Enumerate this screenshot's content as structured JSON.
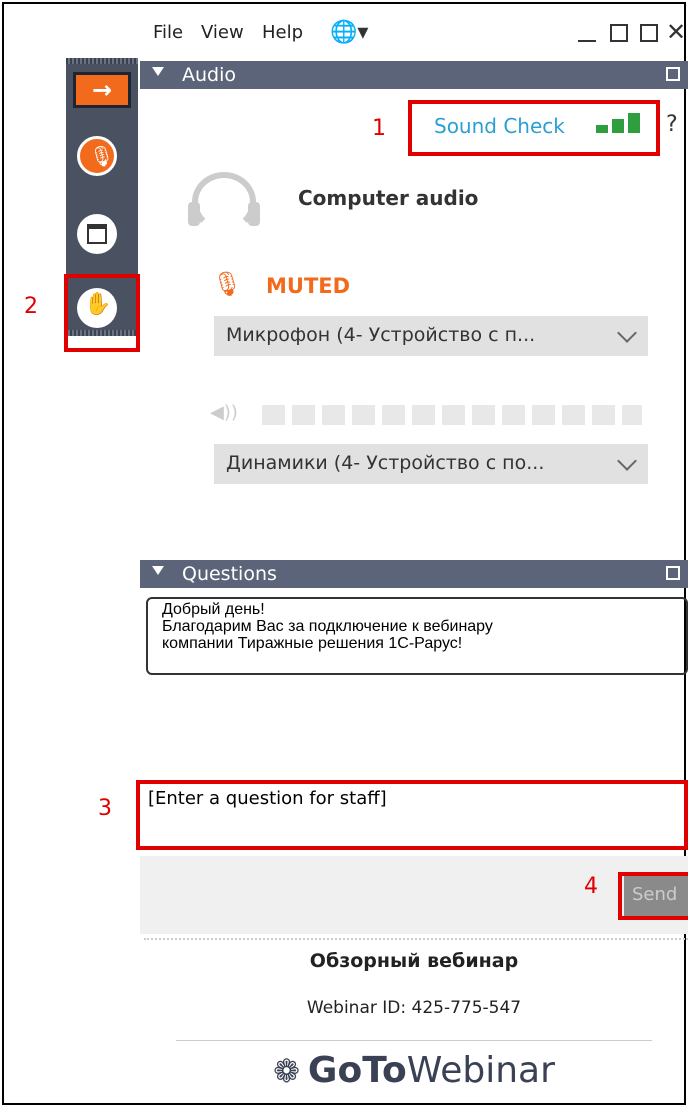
{
  "menu": {
    "file": "File",
    "view": "View",
    "help": "Help"
  },
  "audio": {
    "header": "Audio",
    "sound_check": "Sound Check",
    "help": "?",
    "computer_audio": "Computer audio",
    "muted": "MUTED",
    "mic_device": "Микрофон (4- Устройство с п...",
    "speaker_device": "Динамики (4- Устройство с по...",
    "status_color": "#2e9e3e",
    "muted_color": "#f26b1d"
  },
  "questions": {
    "header": "Questions",
    "message_lines": [
      "Добрый день!",
      "Благодарим Вас за подключение к вебинару",
      "компании Тиражные решения 1С-Рарус!"
    ],
    "input_placeholder": "[Enter a question for staff]",
    "send": "Send"
  },
  "webinar": {
    "title": "Обзорный вебинар",
    "id": "Webinar ID: 425-775-547",
    "brand_bold": "GoTo",
    "brand_light": "Webinar"
  },
  "annotations": {
    "n1": "1",
    "n2": "2",
    "n3": "3",
    "n4": "4"
  }
}
